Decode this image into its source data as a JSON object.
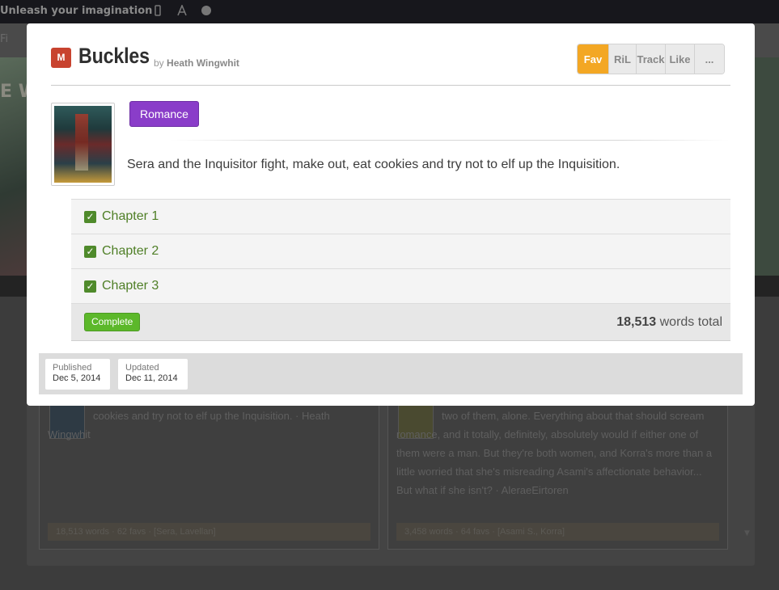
{
  "background": {
    "slogan": "Unleash your imagination",
    "nav_fragment": "Fi",
    "logo_fragment": "E W",
    "cards": [
      {
        "description": "cookies and try not to elf up the Inquisition. · Heath Wingwhit",
        "meta": "18,513 words · 62 favs · [Sera, Lavellan]"
      },
      {
        "description": "two of them, alone. Everything about that should scream romance, and it totally, definitely, absolutely would if either one of them were a man. But they're both women, and Korra's more than a little worried that she's misreading Asami's affectionate behavior... But what if she isn't? · AleraeEirtoren",
        "meta": "3,458 words · 64 favs · [Asami S., Korra]"
      }
    ]
  },
  "story": {
    "rating": "M",
    "title": "Buckles",
    "by_label": "by",
    "author": "Heath Wingwhit",
    "tag": "Romance",
    "description": "Sera and the Inquisitor fight, make out, eat cookies and try not to elf up the Inquisition.",
    "chapters": [
      {
        "title": "Chapter 1",
        "read": true
      },
      {
        "title": "Chapter 2",
        "read": true
      },
      {
        "title": "Chapter 3",
        "read": true
      }
    ],
    "status": "Complete",
    "word_count": "18,513",
    "words_suffix": "words total",
    "published_label": "Published",
    "published_date": "Dec 5, 2014",
    "updated_label": "Updated",
    "updated_date": "Dec 11, 2014"
  },
  "actions": {
    "fav": "Fav",
    "ril": "RiL",
    "track": "Track",
    "like": "Like",
    "more": "..."
  },
  "colors": {
    "rating_badge": "#c8432f",
    "fav_active": "#f3a724",
    "tag": "#8a3dc9",
    "chapter_link": "#4f7f27",
    "status_complete": "#5cb82a"
  }
}
